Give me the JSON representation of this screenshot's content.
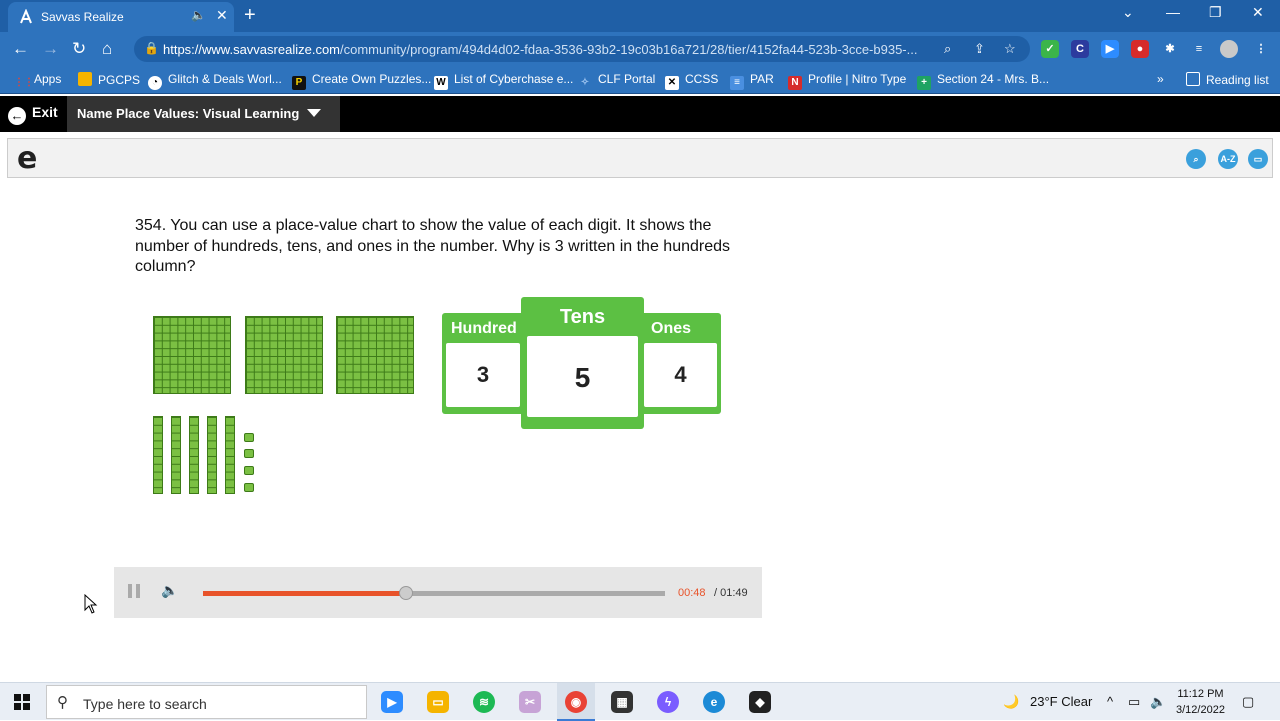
{
  "browser": {
    "tab_title": "Savvas Realize",
    "url_domain": "https://www.savvasrealize.com",
    "url_path": "/community/program/494d4d02-fdaa-3536-93b2-19c03b16a721/28/tier/4152fa44-523b-3cce-b935-...",
    "bookmarks": [
      {
        "label": "Apps",
        "color": "#e94235"
      },
      {
        "label": "PGCPS",
        "color": "#f5b400"
      },
      {
        "label": "Glitch & Deals Worl...",
        "color": "#ffffff"
      },
      {
        "label": "Create Own Puzzles...",
        "color": "#f5d000"
      },
      {
        "label": "List of Cyberchase e...",
        "color": "#ffffff"
      },
      {
        "label": "CLF Portal",
        "color": "#3a7bd5"
      },
      {
        "label": "CCSS",
        "color": "#ffffff"
      },
      {
        "label": "PAR",
        "color": "#4a8fe0"
      },
      {
        "label": "Profile | Nitro Type",
        "color": "#d62b2b"
      },
      {
        "label": "Section 24 - Mrs. B...",
        "color": "#1ea362"
      }
    ],
    "reading_list": "Reading list"
  },
  "app": {
    "exit_label": "Exit",
    "lesson_title": "Name Place Values: Visual Learning"
  },
  "content": {
    "question": "354. You can use a place-value chart to show the value of each digit. It shows the number of hundreds, tens, and ones in the number. Why is 3 written in the hundreds column?",
    "place_value": {
      "hundreds_label": "Hundred",
      "tens_label": "Tens",
      "ones_label": "Ones",
      "hundreds_value": "3",
      "tens_value": "5",
      "ones_value": "4"
    },
    "blocks": {
      "hundreds": 3,
      "tens": 5,
      "ones": 4
    }
  },
  "player": {
    "current_time": "00:48",
    "total_time": "/ 01:49",
    "progress_fraction": 0.44
  },
  "taskbar": {
    "search_placeholder": "Type here to search",
    "weather": "23°F  Clear",
    "time": "11:12 PM",
    "date": "3/12/2022"
  }
}
